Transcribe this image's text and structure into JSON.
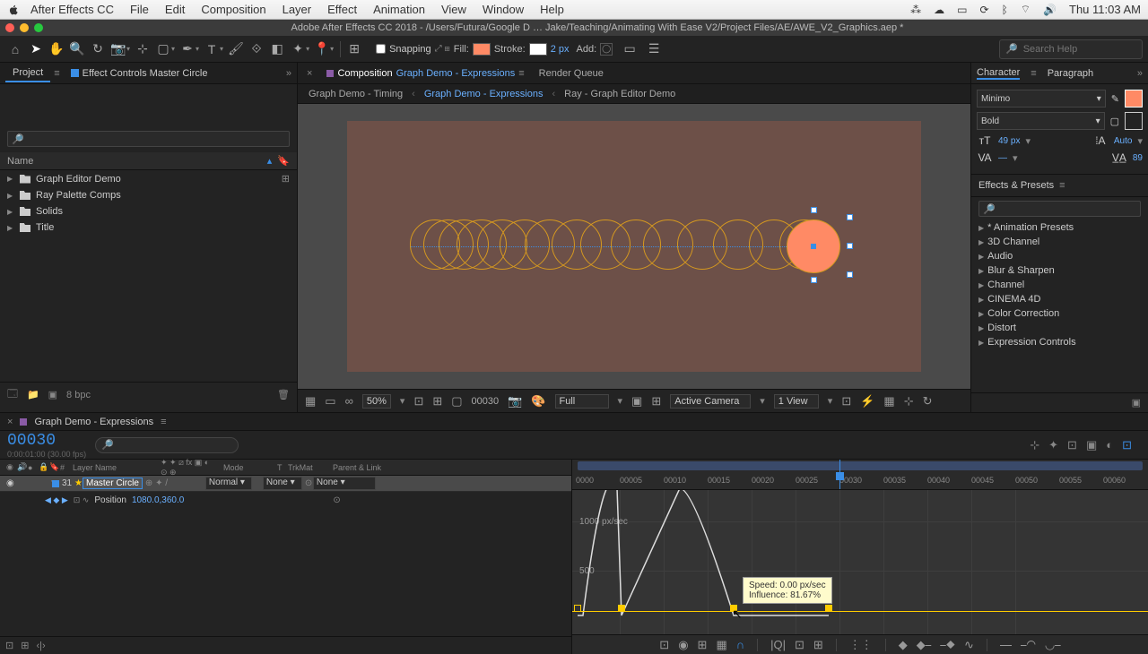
{
  "mac_menu": {
    "app": "After Effects CC",
    "items": [
      "File",
      "Edit",
      "Composition",
      "Layer",
      "Effect",
      "Animation",
      "View",
      "Window",
      "Help"
    ],
    "clock": "Thu 11:03 AM"
  },
  "titlebar": "Adobe After Effects CC 2018 - /Users/Futura/Google D … Jake/Teaching/Animating With Ease V2/Project Files/AE/AWE_V2_Graphics.aep *",
  "toolbar": {
    "snapping": "Snapping",
    "fill_label": "Fill:",
    "stroke_label": "Stroke:",
    "stroke_width": "2 px",
    "add_label": "Add:",
    "search_placeholder": "Search Help"
  },
  "panels": {
    "project_tab": "Project",
    "effect_controls_tab": "Effect Controls Master Circle",
    "name_col": "Name",
    "items": [
      "Graph Editor Demo",
      "Ray Palette Comps",
      "Solids",
      "Title"
    ],
    "bpc": "8 bpc"
  },
  "comp_tabs": {
    "composition": "Composition",
    "comp_name": "Graph Demo - Expressions",
    "render_queue": "Render Queue"
  },
  "breadcrumbs": [
    "Graph Demo - Timing",
    "Graph Demo - Expressions",
    "Ray - Graph Editor Demo"
  ],
  "viewer_footer": {
    "zoom": "50%",
    "frame": "00030",
    "resolution": "Full",
    "camera": "Active Camera",
    "views": "1 View"
  },
  "character": {
    "tab_char": "Character",
    "tab_para": "Paragraph",
    "font": "Minimo",
    "weight": "Bold",
    "size": "49 px",
    "leading": "Auto",
    "tracking": "89"
  },
  "effects_presets": {
    "title": "Effects & Presets",
    "items": [
      "* Animation Presets",
      "3D Channel",
      "Audio",
      "Blur & Sharpen",
      "Channel",
      "CINEMA 4D",
      "Color Correction",
      "Distort",
      "Expression Controls"
    ]
  },
  "timeline": {
    "comp_name": "Graph Demo - Expressions",
    "timecode": "00030",
    "duration": "0:00:01:00 (30.00 fps)",
    "col_layer": "Layer Name",
    "col_mode": "Mode",
    "col_trkmat": "TrkMat",
    "col_parent": "Parent & Link",
    "layer_num": "31",
    "layer_name": "Master Circle",
    "mode": "Normal",
    "trkmat": "None",
    "parent": "None",
    "prop_name": "Position",
    "prop_value": "1080.0,360.0",
    "ticks": [
      "0000",
      "00005",
      "00010",
      "00015",
      "00020",
      "00025",
      "00030",
      "00035",
      "00040",
      "00045",
      "00050",
      "00055",
      "00060"
    ],
    "axis_labels": [
      "1000 px/sec",
      "500"
    ],
    "tooltip_speed": "Speed: 0.00 px/sec",
    "tooltip_influence": "Influence: 81.67%"
  }
}
